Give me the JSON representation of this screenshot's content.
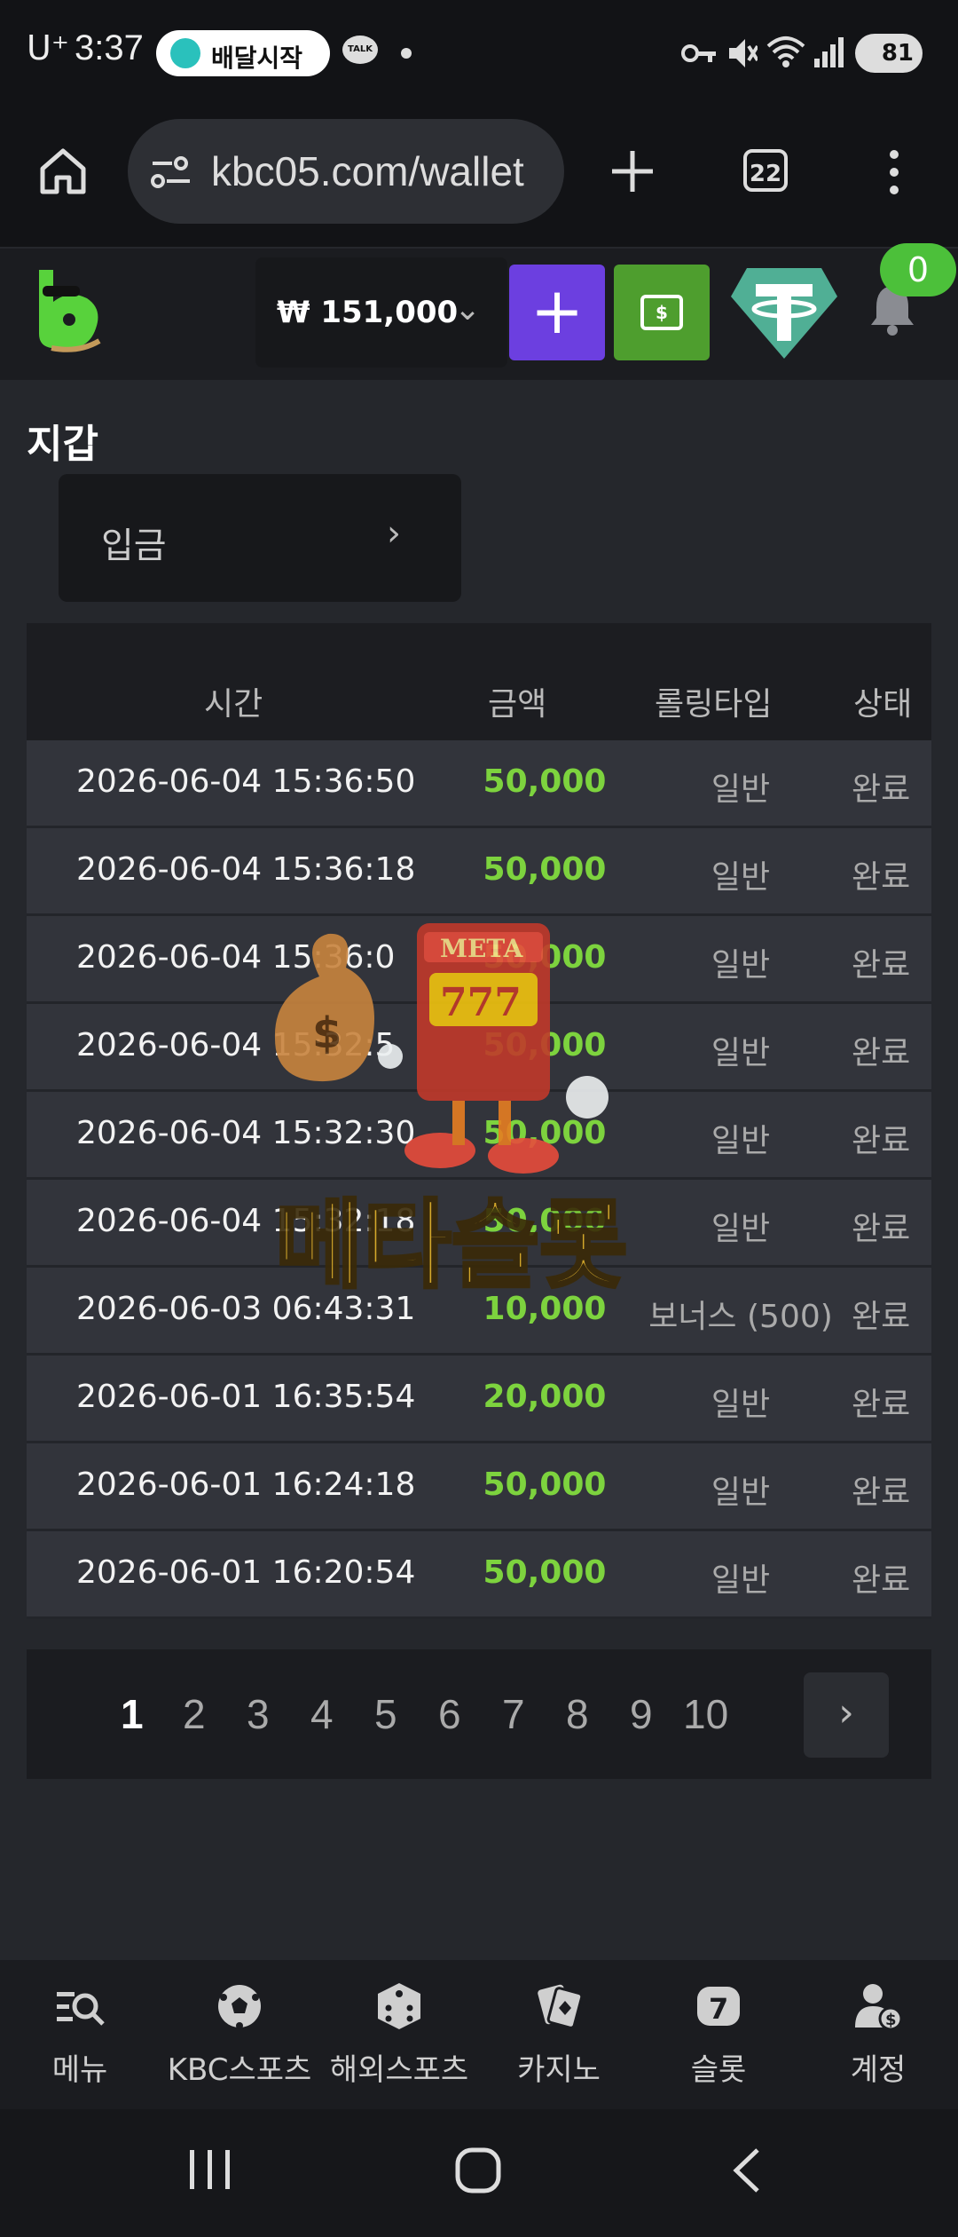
{
  "status_bar": {
    "carrier": "U⁺",
    "time": "3:37",
    "pill_label": "배달시작",
    "talk": "TALK",
    "battery": "81"
  },
  "browser": {
    "url": "kbc05.com/wallet",
    "tab_count": "22"
  },
  "header": {
    "balance": "₩ 151,000",
    "notification_count": "0",
    "cash_icon_text": "$"
  },
  "wallet": {
    "title": "지갑",
    "deposit_label": "입금"
  },
  "table": {
    "headers": [
      "시간",
      "금액",
      "롤링타입",
      "상태"
    ],
    "rows": [
      {
        "time": "2026-06-04 15:36:50",
        "amount": "50,000",
        "rolling": "일반",
        "status": "완료"
      },
      {
        "time": "2026-06-04 15:36:18",
        "amount": "50,000",
        "rolling": "일반",
        "status": "완료"
      },
      {
        "time": "2026-06-04 15:36:0",
        "amount": "50,000",
        "rolling": "일반",
        "status": "완료"
      },
      {
        "time": "2026-06-04 15:32:5",
        "amount": "50,000",
        "rolling": "일반",
        "status": "완료"
      },
      {
        "time": "2026-06-04 15:32:30",
        "amount": "50,000",
        "rolling": "일반",
        "status": "완료"
      },
      {
        "time": "2026-06-04 15:32:18",
        "amount": "50,000",
        "rolling": "일반",
        "status": "완료"
      },
      {
        "time": "2026-06-03 06:43:31",
        "amount": "10,000",
        "rolling": "보너스 (500)",
        "status": "완료"
      },
      {
        "time": "2026-06-01 16:35:54",
        "amount": "20,000",
        "rolling": "일반",
        "status": "완료"
      },
      {
        "time": "2026-06-01 16:24:18",
        "amount": "50,000",
        "rolling": "일반",
        "status": "완료"
      },
      {
        "time": "2026-06-01 16:20:54",
        "amount": "50,000",
        "rolling": "일반",
        "status": "완료"
      }
    ]
  },
  "pagination": {
    "pages": [
      "1",
      "2",
      "3",
      "4",
      "5",
      "6",
      "7",
      "8",
      "9",
      "10"
    ],
    "current": "1"
  },
  "watermark": {
    "sign": "META",
    "reels": "777",
    "text": "메타슬롯"
  },
  "bottom_nav": [
    {
      "label": "메뉴",
      "icon": "menu-search-icon"
    },
    {
      "label": "KBC스포츠",
      "icon": "soccer-ball-icon"
    },
    {
      "label": "해외스포츠",
      "icon": "dice-icon"
    },
    {
      "label": "카지노",
      "icon": "cards-icon"
    },
    {
      "label": "슬롯",
      "icon": "slot-seven-icon"
    },
    {
      "label": "계정",
      "icon": "account-icon"
    }
  ],
  "colors": {
    "amount_green": "#7dd33e",
    "deposit_purple": "#6c3fe0",
    "cash_green": "#4e9e2e",
    "tether_teal": "#50af95"
  }
}
